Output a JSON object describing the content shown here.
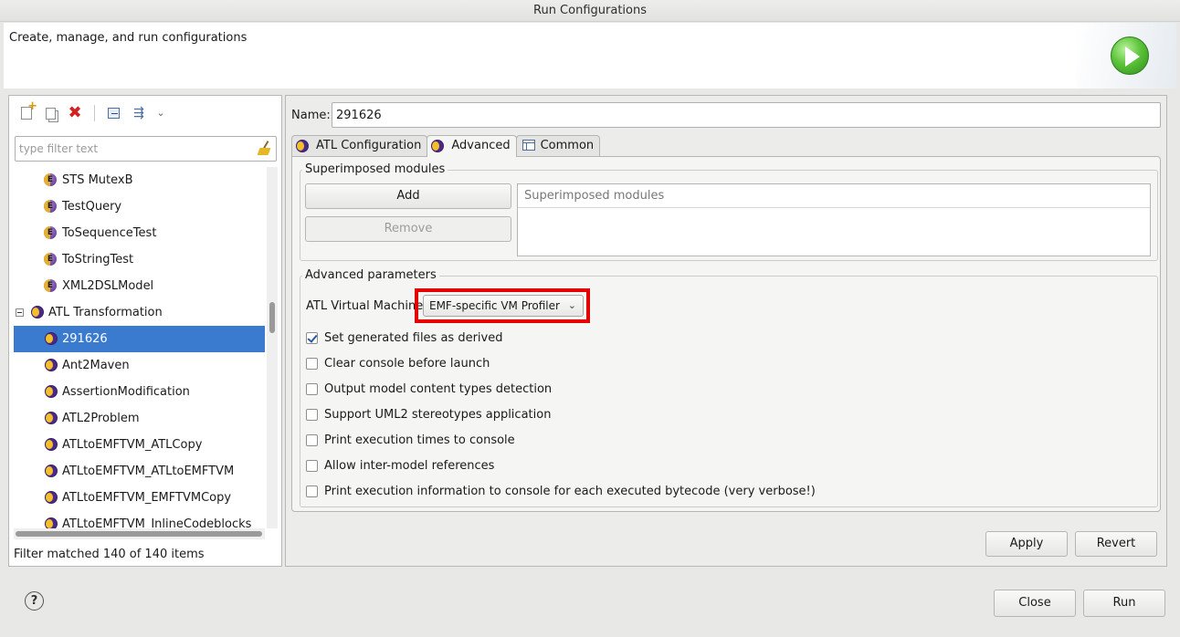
{
  "window": {
    "title": "Run Configurations"
  },
  "header": {
    "description": "Create, manage, and run configurations"
  },
  "filter": {
    "placeholder": "type filter text"
  },
  "tree": {
    "items": [
      {
        "label": "STS MutexB",
        "type": "emftvm"
      },
      {
        "label": "TestQuery",
        "type": "emftvm"
      },
      {
        "label": "ToSequenceTest",
        "type": "emftvm"
      },
      {
        "label": "ToStringTest",
        "type": "emftvm"
      },
      {
        "label": "XML2DSLModel",
        "type": "emftvm"
      },
      {
        "label": "ATL Transformation",
        "type": "category"
      },
      {
        "label": "291626",
        "type": "atl",
        "selected": true
      },
      {
        "label": "Ant2Maven",
        "type": "atl"
      },
      {
        "label": "AssertionModification",
        "type": "atl"
      },
      {
        "label": "ATL2Problem",
        "type": "atl"
      },
      {
        "label": "ATLtoEMFTVM_ATLCopy",
        "type": "atl"
      },
      {
        "label": "ATLtoEMFTVM_ATLtoEMFTVM",
        "type": "atl"
      },
      {
        "label": "ATLtoEMFTVM_EMFTVMCopy",
        "type": "atl"
      },
      {
        "label": "ATLtoEMFTVM_InlineCodeblocks",
        "type": "atl"
      }
    ],
    "status": "Filter matched 140 of 140 items"
  },
  "config": {
    "name_label": "Name:",
    "name_value": "291626",
    "tabs": [
      {
        "label": "ATL Configuration"
      },
      {
        "label": "Advanced",
        "active": true
      },
      {
        "label": "Common"
      }
    ],
    "superimposed": {
      "group_title": "Superimposed modules",
      "add_label": "Add",
      "remove_label": "Remove",
      "table_header": "Superimposed modules"
    },
    "advanced": {
      "group_title": "Advanced parameters",
      "vm_label": "ATL Virtual Machine",
      "vm_value": "EMF-specific VM Profiler",
      "options": [
        {
          "label": "Set generated files as derived",
          "checked": true
        },
        {
          "label": "Clear console before launch",
          "checked": false
        },
        {
          "label": "Output model content types detection",
          "checked": false
        },
        {
          "label": "Support UML2 stereotypes application",
          "checked": false
        },
        {
          "label": "Print execution times to console",
          "checked": false
        },
        {
          "label": "Allow inter-model references",
          "checked": false
        },
        {
          "label": "Print execution information to console for each executed bytecode (very verbose!)",
          "checked": false
        }
      ]
    },
    "apply_label": "Apply",
    "revert_label": "Revert"
  },
  "footer": {
    "help_glyph": "?",
    "close_label": "Close",
    "run_label": "Run"
  },
  "colors": {
    "selection": "#3a7bd0",
    "highlight": "#e40000"
  }
}
